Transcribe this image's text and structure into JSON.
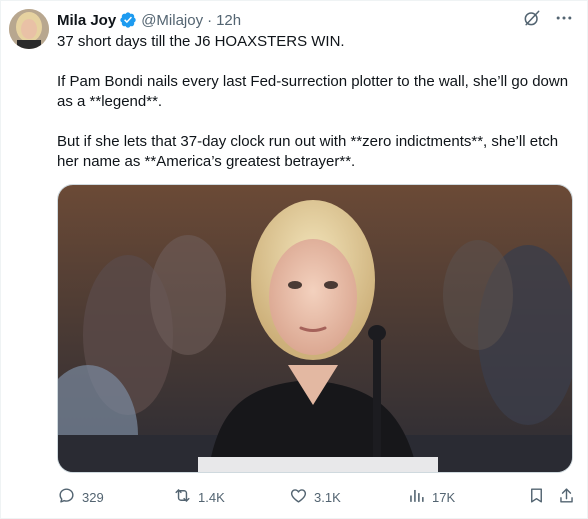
{
  "tweet": {
    "author_name": "Mila Joy",
    "handle": "@Milajoy",
    "separator": "·",
    "time": "12h",
    "paragraphs": [
      "37 short days till the J6 HOAXSTERS WIN.",
      "If Pam Bondi nails every last Fed-surrection plotter to the wall, she’ll go down as a **legend**.",
      "But if she lets that 37-day clock run out with **zero indictments**, she’ll etch her name as **America’s greatest betrayer**."
    ]
  },
  "icons": {
    "verified": "verified-badge-icon",
    "grok": "grok-icon",
    "more": "more-icon",
    "reply": "reply-icon",
    "retweet": "retweet-icon",
    "like": "like-icon",
    "views": "views-icon",
    "bookmark": "bookmark-icon",
    "share": "share-icon"
  },
  "actions": {
    "replies": "329",
    "retweets": "1.4K",
    "likes": "3.1K",
    "views": "17K"
  },
  "colors": {
    "text": "#0f1419",
    "secondary": "#536471",
    "verified": "#1d9bf0",
    "border": "#cfd9de"
  }
}
